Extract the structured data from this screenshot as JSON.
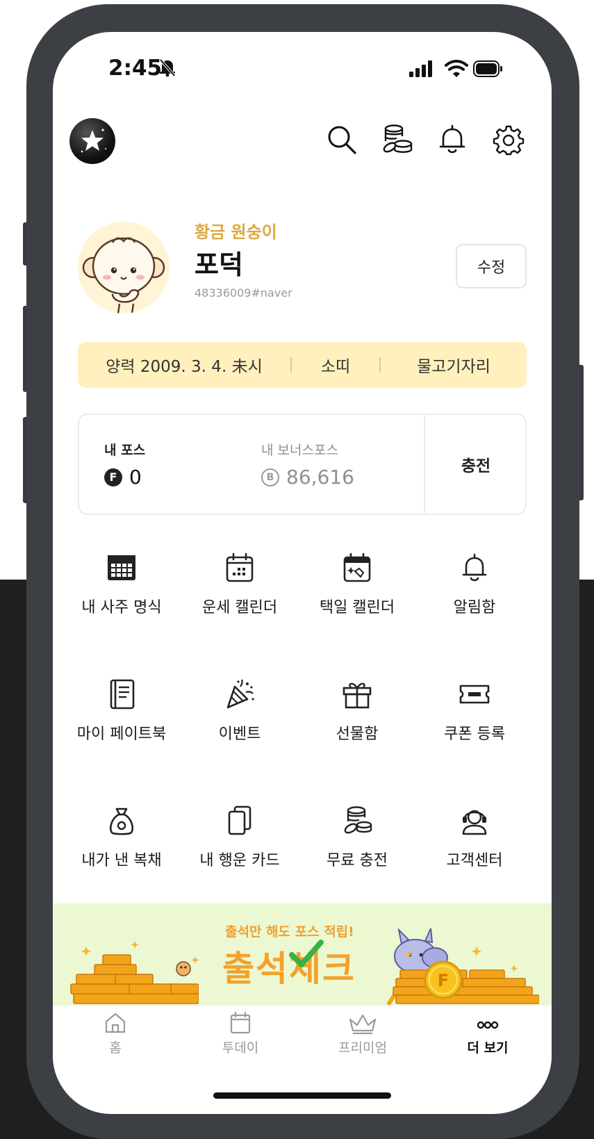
{
  "status_bar": {
    "time": "2:45"
  },
  "header": {
    "logo_icon": "star-logo-icon",
    "icons": [
      "search-icon",
      "coins-icon",
      "bell-icon",
      "gear-icon"
    ]
  },
  "profile": {
    "title": "황금 원숭이",
    "nickname": "포덕",
    "user_id": "48336009#naver",
    "edit_label": "수정"
  },
  "birth_info": {
    "solar": "양력 2009. 3. 4. 未시",
    "zodiac": "소띠",
    "constellation": "물고기자리"
  },
  "points": {
    "my_label": "내 포스",
    "my_value": "0",
    "my_coin": "F",
    "bonus_label": "내 보너스포스",
    "bonus_value": "86,616",
    "bonus_coin": "B",
    "charge_label": "충전"
  },
  "menu": [
    {
      "label": "내 사주 명식",
      "icon": "calendar-grid-icon"
    },
    {
      "label": "운세 캘린더",
      "icon": "calendar-icon"
    },
    {
      "label": "택일 캘린더",
      "icon": "calendar-check-icon"
    },
    {
      "label": "알림함",
      "icon": "bell-icon"
    },
    {
      "label": "마이 페이트북",
      "icon": "book-icon"
    },
    {
      "label": "이벤트",
      "icon": "party-popper-icon"
    },
    {
      "label": "선물함",
      "icon": "gift-icon"
    },
    {
      "label": "쿠폰 등록",
      "icon": "ticket-icon"
    },
    {
      "label": "내가 낸 복채",
      "icon": "money-bag-icon"
    },
    {
      "label": "내 행운 카드",
      "icon": "cards-icon"
    },
    {
      "label": "무료 충전",
      "icon": "coins-icon"
    },
    {
      "label": "고객센터",
      "icon": "headset-icon"
    }
  ],
  "banner": {
    "subtitle": "출석만 해도 포스 적립!",
    "title": "출석체크",
    "coin_letter": "F"
  },
  "tabs": [
    {
      "label": "홈",
      "icon": "home-icon",
      "active": false
    },
    {
      "label": "투데이",
      "icon": "calendar-icon",
      "active": false
    },
    {
      "label": "프리미엄",
      "icon": "crown-icon",
      "active": false
    },
    {
      "label": "더 보기",
      "icon": "more-dots-icon",
      "active": true
    }
  ],
  "colors": {
    "accent_gold": "#dba93f",
    "birth_bar_bg": "#fff0bd",
    "banner_bg": "#ebf8d2",
    "banner_text": "#f4a12a"
  }
}
